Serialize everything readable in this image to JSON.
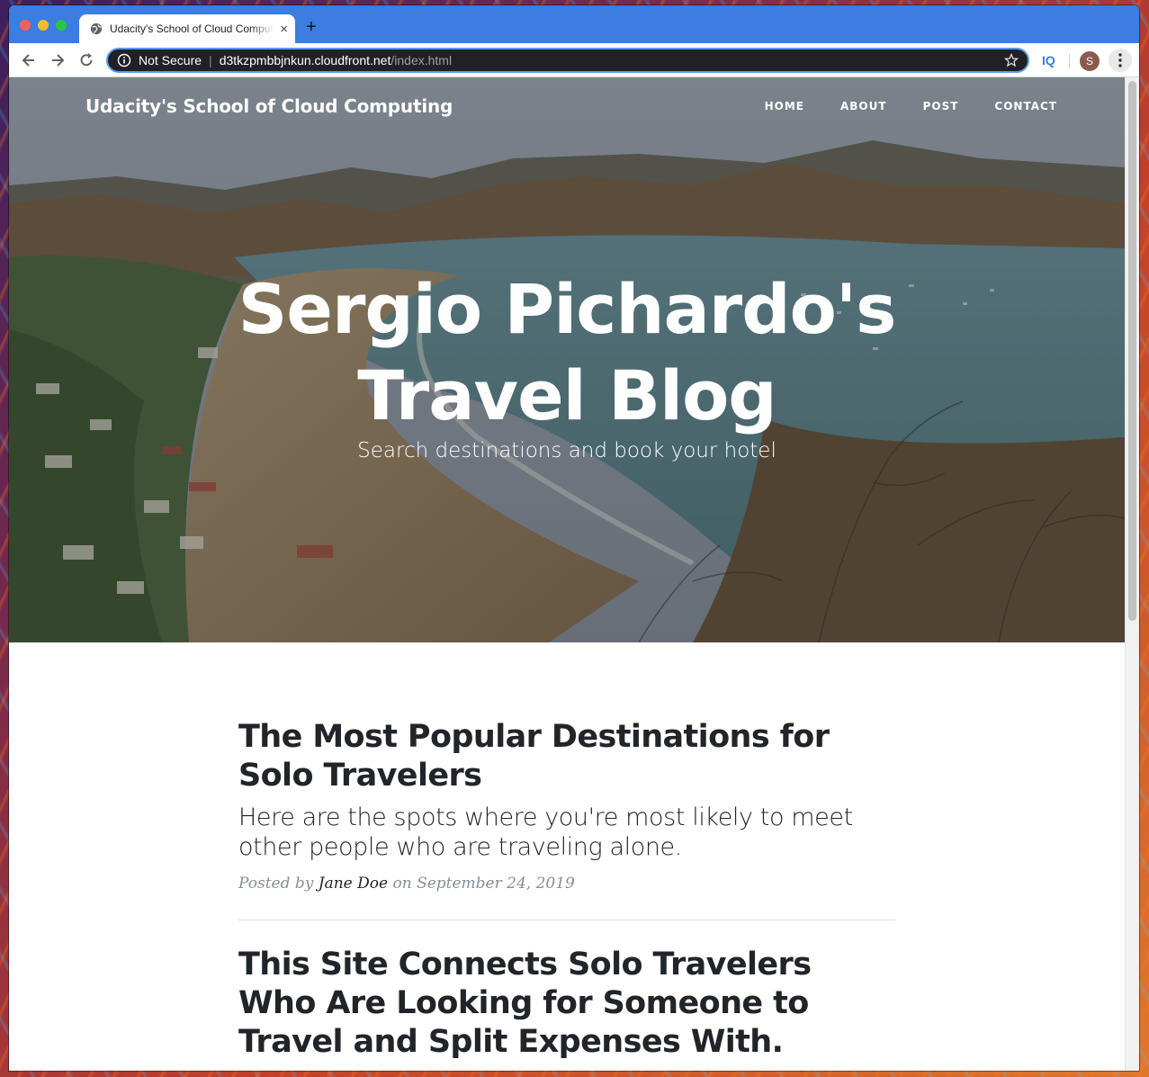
{
  "browser": {
    "tab_title": "Udacity's School of Cloud Computing",
    "security_label": "Not Secure",
    "url_host": "d3tkzpmbbjnkun.cloudfront.net",
    "url_path": "/index.html",
    "extension_label": "IQ",
    "profile_initial": "S",
    "new_tab_label": "+",
    "tab_close_label": "×"
  },
  "site": {
    "brand": "Udacity's School of Cloud Computing",
    "nav": [
      "HOME",
      "ABOUT",
      "POST",
      "CONTACT"
    ],
    "hero_title_line1": "Sergio Pichardo's",
    "hero_title_line2": "Travel Blog",
    "hero_subtitle": "Search destinations and book your hotel"
  },
  "posts": [
    {
      "title": "The Most Popular Destinations for Solo Travelers",
      "subtitle": "Here are the spots where you're most likely to meet other people who are traveling alone.",
      "posted_by": "Posted by",
      "author": "Jane Doe",
      "on": "on",
      "date": "September 24, 2019"
    },
    {
      "title": "This Site Connects Solo Travelers Who Are Looking for Someone to Travel and Split Expenses With."
    }
  ],
  "colors": {
    "tabstrip": "#3b7de0",
    "omnibox": "#202124",
    "heading": "#212529",
    "meta": "#868e96"
  }
}
